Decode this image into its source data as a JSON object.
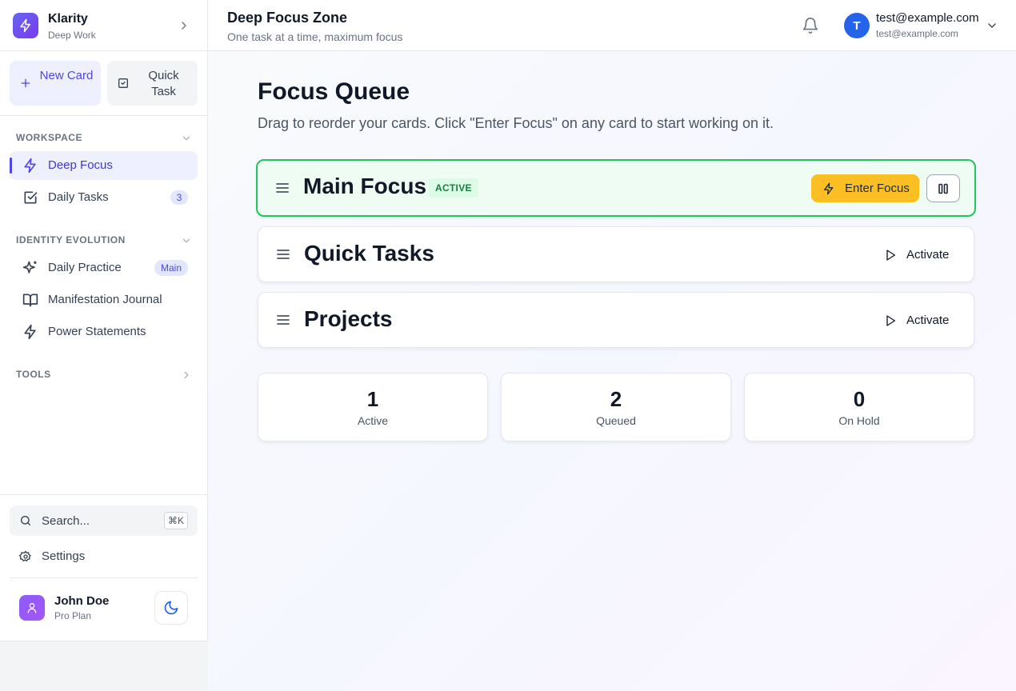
{
  "brand": {
    "name": "Klarity",
    "subtitle": "Deep Work"
  },
  "quick_actions": {
    "new_card": "New Card",
    "quick_task": "Quick Task"
  },
  "sidebar": {
    "workspace_heading": "WORKSPACE",
    "workspace_items": [
      {
        "label": "Deep Focus",
        "active": true
      },
      {
        "label": "Daily Tasks",
        "badge": "3"
      }
    ],
    "identity_heading": "IDENTITY EVOLUTION",
    "identity_items": [
      {
        "label": "Daily Practice",
        "badge": "Main"
      },
      {
        "label": "Manifestation Journal"
      },
      {
        "label": "Power Statements"
      }
    ],
    "tools_heading": "TOOLS",
    "search_placeholder": "Search...",
    "search_shortcut": "⌘K",
    "settings_label": "Settings",
    "user": {
      "name": "John Doe",
      "plan": "Pro Plan"
    }
  },
  "header": {
    "title": "Deep Focus Zone",
    "subtitle": "One task at a time, maximum focus",
    "account": {
      "initial": "T",
      "name": "test@example.com",
      "email": "test@example.com"
    }
  },
  "main": {
    "title": "Focus Queue",
    "description": "Drag to reorder your cards. Click \"Enter Focus\" on any card to start working on it.",
    "cards": [
      {
        "title": "Main Focus",
        "status": "ACTIVE",
        "action": "Enter Focus"
      },
      {
        "title": "Quick Tasks",
        "action": "Activate"
      },
      {
        "title": "Projects",
        "action": "Activate"
      }
    ],
    "stats": [
      {
        "value": "1",
        "label": "Active"
      },
      {
        "value": "2",
        "label": "Queued"
      },
      {
        "value": "0",
        "label": "On Hold"
      }
    ]
  },
  "colors": {
    "accent": "#4f46e5",
    "active_border": "#22c55e",
    "enter_focus": "#fbbf24",
    "avatar": "#2563eb"
  }
}
